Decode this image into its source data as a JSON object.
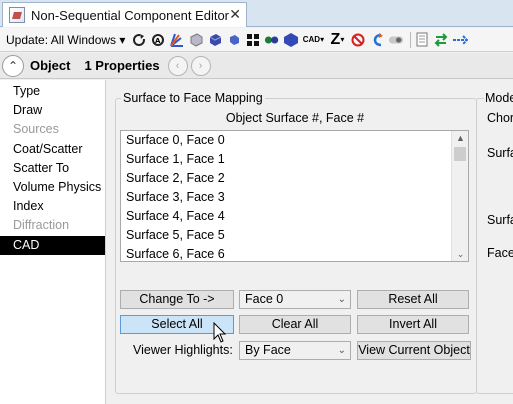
{
  "window": {
    "tab_title": "Non-Sequential Component Editor",
    "close_glyph": "✕",
    "tab_icon": "zemax-editor-icon"
  },
  "toolbar": {
    "update_label": "Update: All Windows",
    "update_arrow": "▾",
    "cad_label": "CAD",
    "z_label": "Z",
    "icons": [
      "refresh-icon",
      "refresh-all-icon",
      "ray-trace-icon",
      "object-properties-icon",
      "shaded-model-icon",
      "solid-model-icon",
      "layout-icon",
      "color-icon",
      "polygon-icon",
      "cad-icon",
      "z-icon",
      "no-icon",
      "arrow-icon",
      "toggle-icon",
      "document-icon",
      "arrows-green-icon",
      "arrows-blue-icon"
    ]
  },
  "object_bar": {
    "object_label": "Object",
    "properties_label": "1 Properties",
    "prev_glyph": "‹",
    "next_glyph": "›",
    "collapse_glyph": "⌃"
  },
  "sidebar": {
    "items": [
      {
        "label": "Type",
        "state": "normal"
      },
      {
        "label": "Draw",
        "state": "normal"
      },
      {
        "label": "Sources",
        "state": "disabled"
      },
      {
        "label": "Coat/Scatter",
        "state": "normal"
      },
      {
        "label": "Scatter To",
        "state": "normal"
      },
      {
        "label": "Volume Physics",
        "state": "normal"
      },
      {
        "label": "Index",
        "state": "normal"
      },
      {
        "label": "Diffraction",
        "state": "disabled"
      },
      {
        "label": "CAD",
        "state": "selected"
      }
    ]
  },
  "mapping": {
    "group_title": "Surface to Face Mapping",
    "column_header": "Object Surface #, Face #",
    "list_items": [
      "Surface 0, Face 0",
      "Surface 1, Face 1",
      "Surface 2, Face 2",
      "Surface 3, Face 3",
      "Surface 4, Face 4",
      "Surface 5, Face 5",
      "Surface 6, Face 6"
    ],
    "scroll_up": "▲",
    "scroll_down": "⌄",
    "change_to_label": "Change To ->",
    "face_value": "Face 0",
    "reset_all_label": "Reset All",
    "select_all_label": "Select All",
    "clear_all_label": "Clear All",
    "invert_all_label": "Invert All",
    "viewer_highlights_label": "Viewer Highlights:",
    "viewer_highlights_value": "By Face",
    "view_current_label": "View Current Object",
    "combo_arrow": "⌄"
  },
  "model_group": {
    "title": "Mode",
    "labels": [
      "Chor",
      "Surfa",
      "Surfa",
      "Face"
    ]
  },
  "colors": {
    "title_bar": "#d9e4f1",
    "selected_nav": "#000000",
    "active_button": "#cce4f7"
  }
}
